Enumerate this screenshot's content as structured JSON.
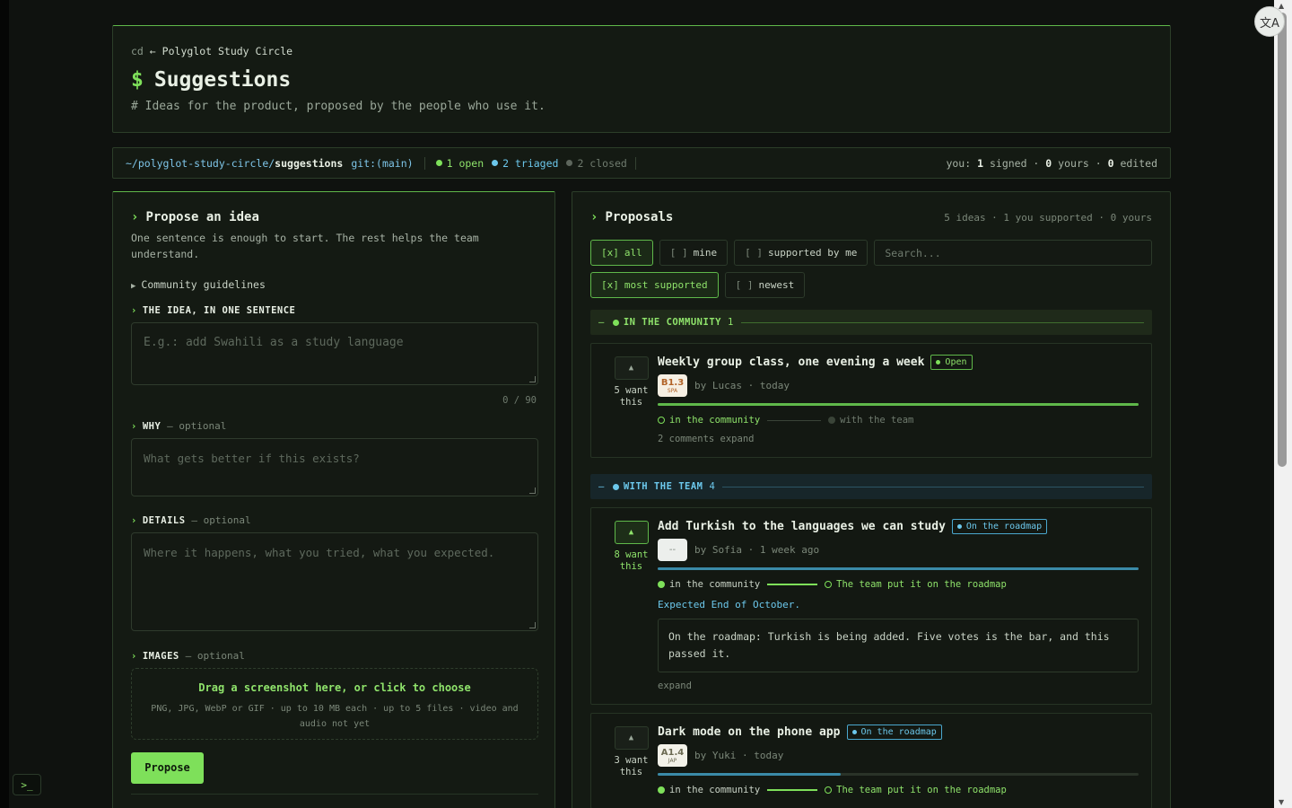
{
  "header": {
    "crumb_prefix": "cd",
    "crumb_arrow": "←",
    "crumb_name": "Polyglot Study Circle",
    "title_prompt": "$",
    "title": "Suggestions",
    "subtitle": "# Ideas for the product, proposed by the people who use it."
  },
  "status_bar": {
    "path_prefix": "~/polyglot-study-circle/",
    "path_current": "suggestions",
    "git_label": "git:(main)",
    "open_label": "1 open",
    "triaged_label": "2 triaged",
    "closed_label": "2 closed",
    "you_prefix": "you:",
    "signed_count": "1",
    "signed_label": "signed ·",
    "yours_count": "0",
    "yours_label": "yours ·",
    "edited_count": "0",
    "edited_label": "edited"
  },
  "propose": {
    "title": "Propose an idea",
    "hint": "One sentence is enough to start. The rest helps the team understand.",
    "guidelines_label": "Community guidelines",
    "idea_label": "THE IDEA, IN ONE SENTENCE",
    "idea_placeholder": "E.g.: add Swahili as a study language",
    "idea_counter": "0 / 90",
    "why_label": "WHY",
    "why_optional": "— optional",
    "why_placeholder": "What gets better if this exists?",
    "details_label": "DETAILS",
    "details_optional": "— optional",
    "details_placeholder": "Where it happens, what you tried, what you expected.",
    "images_label": "IMAGES",
    "images_optional": "— optional",
    "drop_main": "Drag a screenshot here, or click to choose",
    "drop_sub": "PNG, JPG, WebP or GIF · up to 10 MB each · up to 5 files · video and audio not yet",
    "submit_label": "Propose"
  },
  "proposals": {
    "title": "Proposals",
    "summary": "5 ideas · 1 you supported · 0 yours",
    "filters": [
      {
        "box": "[x]",
        "label": "all",
        "active": true
      },
      {
        "box": "[ ]",
        "label": "mine",
        "active": false
      },
      {
        "box": "[ ]",
        "label": "supported by me",
        "active": false
      }
    ],
    "search_placeholder": "Search...",
    "sorts": [
      {
        "box": "[x]",
        "label": "most supported",
        "active": true
      },
      {
        "box": "[ ]",
        "label": "newest",
        "active": false
      }
    ],
    "group_community": {
      "dash": "—",
      "label": "IN THE COMMUNITY",
      "count": "1"
    },
    "group_team": {
      "dash": "—",
      "label": "WITH THE TEAM",
      "count": "4"
    },
    "cards": [
      {
        "votes": "5 want this",
        "voted": false,
        "title": "Weekly group class, one evening a week",
        "status": "Open",
        "level": "B1.3",
        "level_lang": "SPA",
        "author": "by Lucas · today",
        "progress": 1.0,
        "step1": "in the community",
        "step2": "with the team",
        "footer": "2 comments  expand"
      },
      {
        "votes": "8 want this",
        "voted": true,
        "title": "Add Turkish to the languages we can study",
        "status": "On the roadmap",
        "level": "--",
        "level_lang": "",
        "author": "by Sofia · 1 week ago",
        "progress": 1.0,
        "step1": "in the community",
        "step2": "The team put it on the roadmap",
        "expected": "Expected End of October.",
        "note": "On the roadmap: Turkish is being added. Five votes is the bar, and this passed it.",
        "footer": "expand"
      },
      {
        "votes": "3 want this",
        "voted": false,
        "title": "Dark mode on the phone app",
        "status": "On the roadmap",
        "level": "A1.4",
        "level_lang": "JAP",
        "author": "by Yuki · today",
        "progress": 0.38,
        "step1": "in the community",
        "step2": "The team put it on the roadmap"
      }
    ]
  },
  "colors": {
    "accent_green": "#7ee05a",
    "accent_teal": "#6cc8ec",
    "background": "#0f120f"
  },
  "icons": {
    "translate": "translate-icon",
    "terminal": "terminal-icon"
  }
}
